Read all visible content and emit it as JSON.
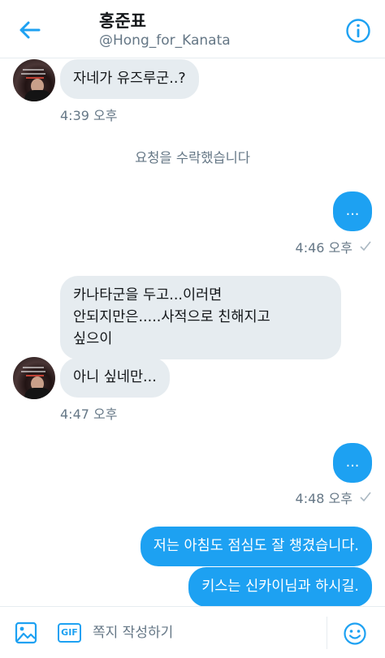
{
  "header": {
    "name": "홍준표",
    "handle": "@Hong_for_Kanata"
  },
  "conversation": {
    "msg1": "자네가 유즈루군..?",
    "ts1": "4:39 오후",
    "system": "요청을 수락했습니다",
    "msg2": "...",
    "ts2": "4:46 오후",
    "msg3": "카나타군을 두고...이러면\n안되지만은.....사적으로 친해지고\n싶으이",
    "msg4": "아니 싶네만...",
    "ts3": "4:47 오후",
    "msg5": "...",
    "ts4": "4:48 오후",
    "msg6": "저는 아침도 점심도 잘 챙겼습니다.",
    "msg7": "키스는 신카이님과 하시길."
  },
  "composer": {
    "placeholder": "쪽지 작성하기",
    "gif_label": "GIF"
  },
  "icons": {
    "back": "arrow-left-icon",
    "info": "info-icon",
    "image": "image-icon",
    "gif": "gif-icon",
    "emoji": "emoji-icon",
    "sent": "checkmark-icon"
  },
  "colors": {
    "accent": "#1da1f2",
    "incoming_bubble": "#e6ecf0",
    "muted_text": "#657786"
  }
}
